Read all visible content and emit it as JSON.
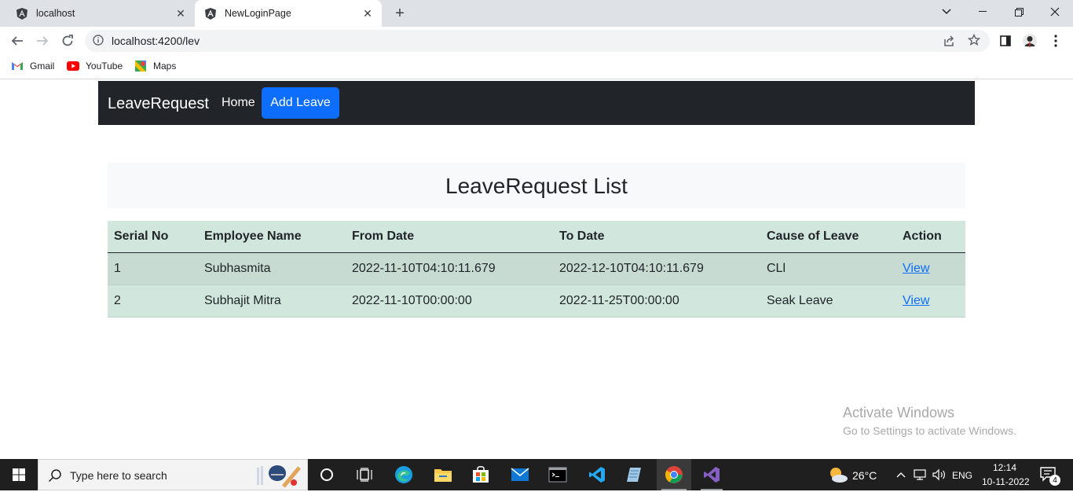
{
  "browser": {
    "tabs": [
      {
        "title": "localhost",
        "active": false
      },
      {
        "title": "NewLoginPage",
        "active": true
      }
    ],
    "url": "localhost:4200/lev",
    "bookmarks": [
      "Gmail",
      "YouTube",
      "Maps"
    ]
  },
  "navbar": {
    "brand": "LeaveRequest",
    "home": "Home",
    "add_leave": "Add Leave"
  },
  "page": {
    "title": "LeaveRequest List"
  },
  "table": {
    "headers": [
      "Serial No",
      "Employee Name",
      "From Date",
      "To Date",
      "Cause of Leave",
      "Action"
    ],
    "rows": [
      {
        "serial": "1",
        "name": "Subhasmita",
        "from": "2022-11-10T04:10:11.679",
        "to": "2022-12-10T04:10:11.679",
        "cause": "CLl",
        "action": "View"
      },
      {
        "serial": "2",
        "name": "Subhajit Mitra",
        "from": "2022-11-10T00:00:00",
        "to": "2022-11-25T00:00:00",
        "cause": "Seak Leave",
        "action": "View"
      }
    ]
  },
  "watermark": {
    "line1": "Activate Windows",
    "line2": "Go to Settings to activate Windows."
  },
  "taskbar": {
    "search_placeholder": "Type here to search",
    "temperature": "26°C",
    "language": "ENG",
    "time": "12:14",
    "date": "10-11-2022",
    "notification_count": "4"
  },
  "colors": {
    "navbar_bg": "#212529",
    "primary": "#0d6efd",
    "table_success": "#d1e7dd",
    "light_band": "#f8f9fa"
  }
}
